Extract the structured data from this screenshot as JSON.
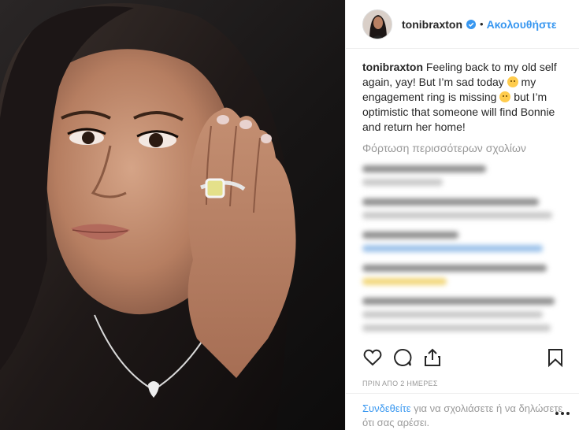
{
  "header": {
    "username": "tonibraxton",
    "verified": true,
    "separator": "•",
    "follow_label": "Ακολουθήστε"
  },
  "caption": {
    "username": "tonibraxton",
    "text_1": "Feeling back to my old self again, yay! But I’m sad today",
    "text_2": "my engagement ring is missing",
    "text_3": "but I’m optimistic that someone will find Bonnie and return her home!",
    "emoji_1": "sad-face-emoji",
    "emoji_2": "disappointed-face-emoji"
  },
  "comments": {
    "load_more_label": "Φόρτωση περισσότερων σχολίων",
    "blurred": true
  },
  "actions": {
    "like_icon": "heart-icon",
    "comment_icon": "comment-bubble-icon",
    "share_icon": "share-upload-icon",
    "save_icon": "bookmark-icon"
  },
  "timestamp": "ΠΡΙΝ ΑΠΟ 2 ΗΜΕΡΕΣ",
  "footer": {
    "login_link": "Συνδεθείτε",
    "login_text": "για να σχολιάσετε ή να δηλώσετε ότι σας αρέσει.",
    "options_icon": "more-options-icon"
  },
  "colors": {
    "accent": "#3897f0",
    "text": "#262626",
    "muted": "#999999",
    "border": "#efefef"
  }
}
